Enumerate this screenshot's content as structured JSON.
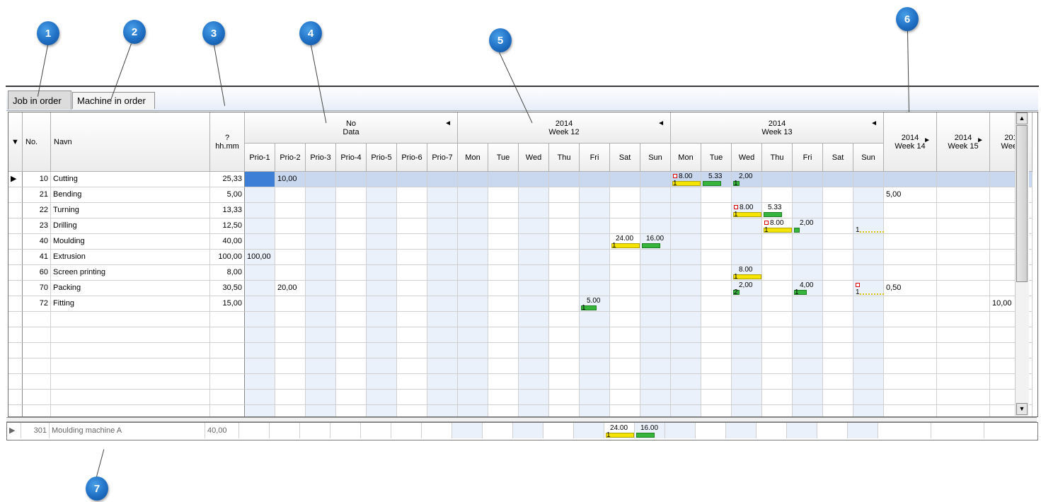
{
  "callouts": [
    "1",
    "2",
    "3",
    "4",
    "5",
    "6",
    "7"
  ],
  "tabs": [
    {
      "label": "Job in order",
      "active": true
    },
    {
      "label": "Machine in order",
      "active": false
    }
  ],
  "columns": {
    "no": "No.",
    "name": "Navn",
    "hours_top": "?",
    "hours_bottom": "hh.mm"
  },
  "groups": [
    {
      "line1": "No",
      "line2": "Data"
    },
    {
      "line1": "2014",
      "line2": "Week 12"
    },
    {
      "line1": "2014",
      "line2": "Week 13"
    },
    {
      "line1": "2014",
      "line2": "Week 14"
    },
    {
      "line1": "2014",
      "line2": "Week 15"
    },
    {
      "line1": "201",
      "line2": "Week"
    }
  ],
  "prio_cols": [
    "Prio-1",
    "Prio-2",
    "Prio-3",
    "Prio-4",
    "Prio-5",
    "Prio-6",
    "Prio-7"
  ],
  "day_cols": [
    "Mon",
    "Tue",
    "Wed",
    "Thu",
    "Fri",
    "Sat",
    "Sun"
  ],
  "rows": [
    {
      "no": "10",
      "name": "Cutting",
      "hours": "25,33",
      "prio2": "10,00"
    },
    {
      "no": "21",
      "name": "Bending",
      "hours": "5,00",
      "w14": "5,00"
    },
    {
      "no": "22",
      "name": "Turning",
      "hours": "13,33"
    },
    {
      "no": "23",
      "name": "Drilling",
      "hours": "12,50"
    },
    {
      "no": "40",
      "name": "Moulding",
      "hours": "40,00"
    },
    {
      "no": "41",
      "name": "Extrusion",
      "hours": "100,00",
      "prio1": "100,00"
    },
    {
      "no": "60",
      "name": "Screen printing",
      "hours": "8,00"
    },
    {
      "no": "70",
      "name": "Packing",
      "hours": "30,50",
      "prio2": "20,00",
      "w14": "0,50"
    },
    {
      "no": "72",
      "name": "Fitting",
      "hours": "15,00",
      "w16": "10,00"
    }
  ],
  "bar_labels": {
    "r0_mon": "8.00",
    "r0_tue": "5.33",
    "r0_wed": "2,00",
    "r2_wed": "8.00",
    "r2_thu": "5.33",
    "r3_thu": "8.00",
    "r3_fri": "2,00",
    "r4_sat": "24.00",
    "r4_sun": "16.00",
    "r6_wed": "8.00",
    "r7_wed": "2,00",
    "r7_fri": "4,00",
    "r8_fri": "5.00",
    "one": "1",
    "two": "2"
  },
  "bottom_row": {
    "no": "301",
    "name": "Moulding machine A",
    "hours": "40,00",
    "sat": "24.00",
    "sun": "16.00"
  },
  "colors": {
    "callout": "#1f6fc4",
    "bar_yellow": "#f5e300",
    "bar_green": "#37b43c",
    "alt_column": "#eaf1fb",
    "selected_row": "#c9d8ef"
  }
}
